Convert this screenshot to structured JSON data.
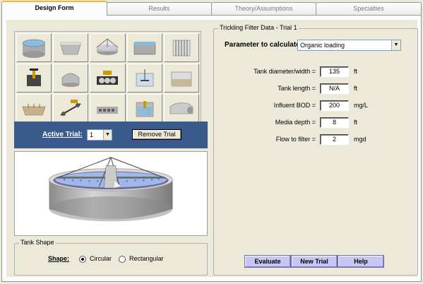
{
  "tabs": [
    {
      "label": "Design Form",
      "active": true
    },
    {
      "label": "Results",
      "active": false
    },
    {
      "label": "Theory/Assumptions",
      "active": false
    },
    {
      "label": "Specialties",
      "active": false
    }
  ],
  "trial": {
    "label": "Active Trial:",
    "value": "1",
    "remove_label": "Remove Trial"
  },
  "tank_shape": {
    "title": "Tank Shape",
    "shape_label": "Shape:",
    "options": [
      "Circular",
      "Rectangular"
    ],
    "selected": "Circular"
  },
  "data": {
    "title": "Trickling Filter Data - Trial 1",
    "param_label": "Parameter to calculate:",
    "param_value": "Organic loading",
    "fields": [
      {
        "label": "Tank diameter/width =",
        "value": "135",
        "unit": "ft"
      },
      {
        "label": "Tank length =",
        "value": "N/A",
        "unit": "ft"
      },
      {
        "label": "Influent BOD =",
        "value": "200",
        "unit": "mg/L"
      },
      {
        "label": "Media depth =",
        "value": "8",
        "unit": "ft"
      },
      {
        "label": "Flow to filter =",
        "value": "2",
        "unit": "mgd"
      }
    ]
  },
  "actions": {
    "evaluate": "Evaluate",
    "new_trial": "New Trial",
    "help": "Help"
  },
  "colors": {
    "trial_bar": "#3a5a8c",
    "action_button": "#c7c7f5",
    "active_tab_accent": "#f1b53a"
  },
  "icons": [
    "clarifier-tank-icon",
    "grit-chamber-icon",
    "trickling-filter-icon",
    "aeration-basin-icon",
    "bar-screen-icon",
    "mixer-tank-icon",
    "digester-icon",
    "rotating-contactor-icon",
    "flash-mixer-icon",
    "sand-filter-icon",
    "lagoon-icon",
    "belt-press-icon",
    "sludge-drying-icon",
    "uv-channel-icon",
    "pipe-culvert-icon"
  ]
}
